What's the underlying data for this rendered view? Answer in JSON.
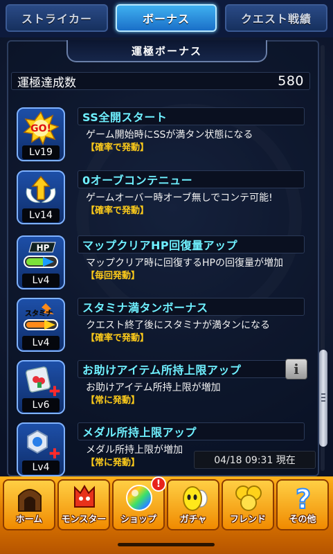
{
  "tabs": [
    {
      "label": "ストライカー",
      "active": false
    },
    {
      "label": "ボーナス",
      "active": true
    },
    {
      "label": "クエスト戦績",
      "active": false
    }
  ],
  "panel_title": "運極ボーナス",
  "count": {
    "label": "運極達成数",
    "value": "580"
  },
  "bonuses": [
    {
      "level": "Lv19",
      "name": "SS全開スタート",
      "description": "ゲーム開始時にSSが満タン状態になる",
      "trigger": "【確率で発動】",
      "icon": "go-burst-icon"
    },
    {
      "level": "Lv14",
      "name": "0オーブコンテニュー",
      "description": "ゲームオーバー時オーブ無しでコンテ可能!",
      "trigger": "【確率で発動】",
      "icon": "winged-arrow-icon"
    },
    {
      "level": "Lv4",
      "name": "マップクリアHP回復量アップ",
      "description": "マップクリア時に回復するHPの回復量が増加",
      "trigger": "【毎回発動】",
      "icon": "hp-gauge-icon"
    },
    {
      "level": "Lv4",
      "name": "スタミナ満タンボーナス",
      "description": "クエスト終了後にスタミナが満タンになる",
      "trigger": "【確率で発動】",
      "icon": "stamina-gauge-icon"
    },
    {
      "level": "Lv6",
      "name": "お助けアイテム所持上限アップ",
      "description": "お助けアイテム所持上限が増加",
      "trigger": "【常に発動】",
      "icon": "item-plus-icon"
    },
    {
      "level": "Lv4",
      "name": "メダル所持上限アップ",
      "description": "メダル所持上限が増加",
      "trigger": "【常に発動】",
      "icon": "medal-plus-icon"
    }
  ],
  "info_button_label": "i",
  "timestamp": "04/18 09:31 現在",
  "bottom_nav": [
    {
      "label": "ホーム",
      "icon": "home-icon"
    },
    {
      "label": "モンスター",
      "icon": "monster-icon"
    },
    {
      "label": "ショップ",
      "icon": "shop-orb-icon"
    },
    {
      "label": "ガチャ",
      "icon": "gacha-egg-icon"
    },
    {
      "label": "フレンド",
      "icon": "friend-icon"
    },
    {
      "label": "その他",
      "icon": "other-icon"
    }
  ],
  "shop_badge": "!"
}
